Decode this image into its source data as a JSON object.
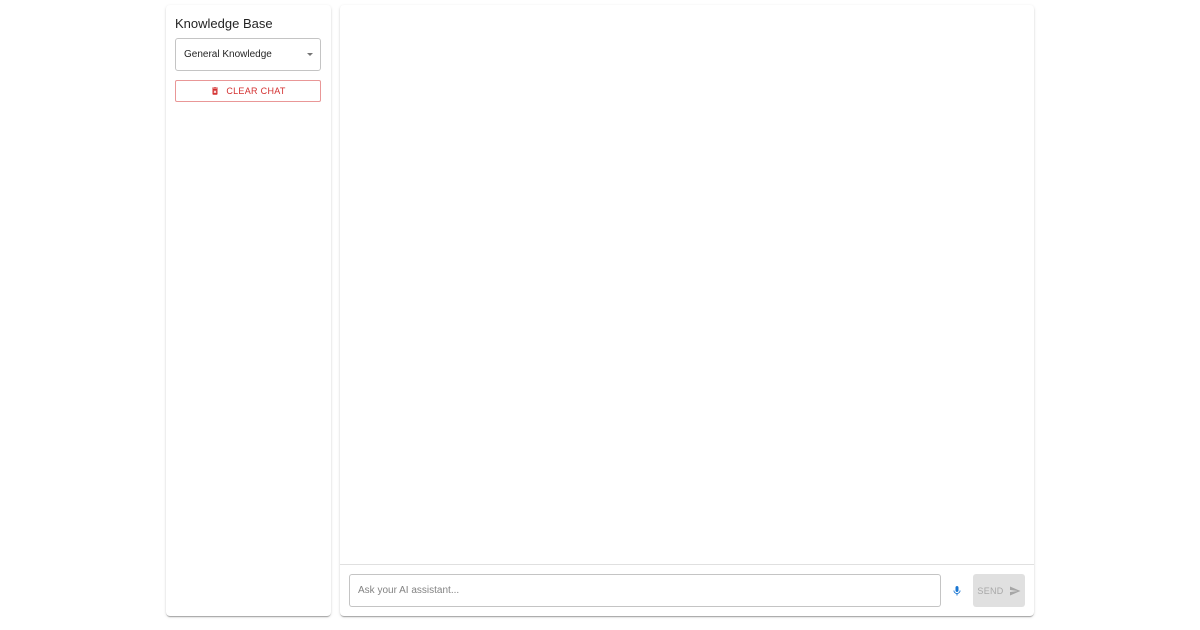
{
  "sidebar": {
    "title": "Knowledge Base",
    "select": {
      "value": "General Knowledge",
      "icon": "arrow-drop-down-icon"
    },
    "clear_button": {
      "label": "CLEAR CHAT",
      "icon": "trash-icon"
    }
  },
  "chat": {
    "input": {
      "placeholder": "Ask your AI assistant...",
      "value": ""
    },
    "mic": {
      "icon": "microphone-icon"
    },
    "send_button": {
      "label": "SEND",
      "icon": "send-icon",
      "disabled": true
    }
  },
  "colors": {
    "danger": "#d32f2f",
    "primary": "#1976d2",
    "disabled_bg": "#e0e0e0",
    "disabled_text": "#bdbdbd"
  }
}
